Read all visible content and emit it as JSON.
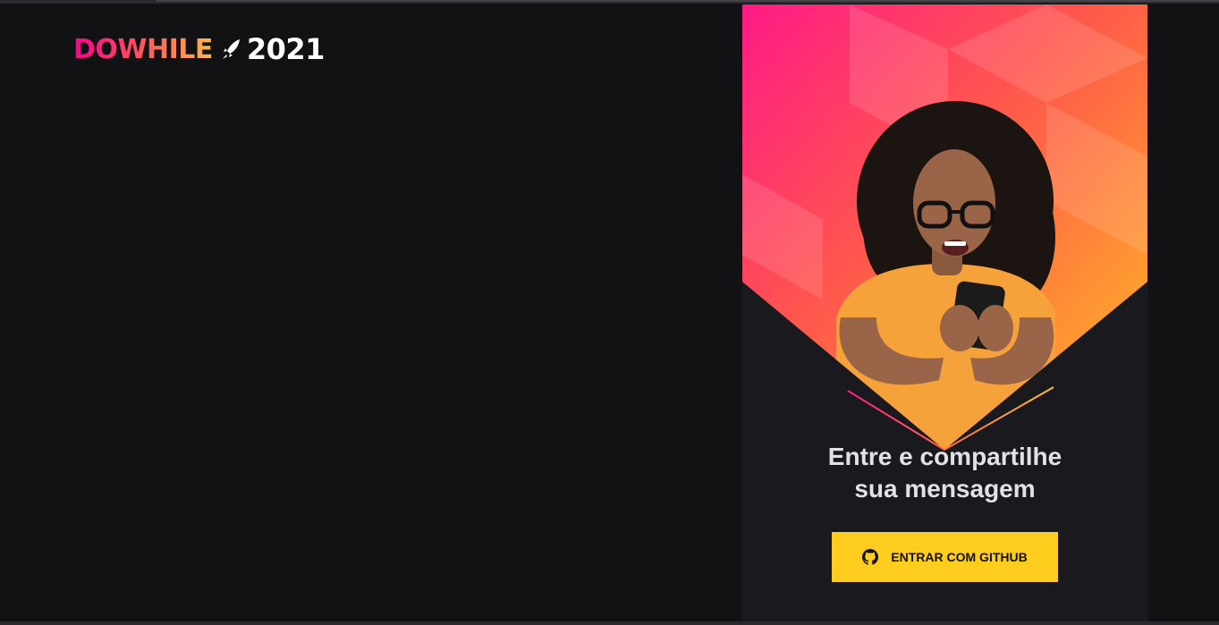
{
  "logo": {
    "brand": "DOWHILE",
    "year": "2021",
    "rocket_icon": "rocket-icon"
  },
  "login": {
    "message_line1": "Entre e compartilhe",
    "message_line2": "sua mensagem",
    "button_label": "ENTRAR COM GITHUB",
    "button_icon": "github-icon"
  },
  "colors": {
    "background": "#121214",
    "panel": "#1a1a1e",
    "accent_pink": "#ff008e",
    "accent_orange": "#ff8a3d",
    "accent_yellow": "#ffcd1e",
    "text": "#e1e1e6"
  }
}
